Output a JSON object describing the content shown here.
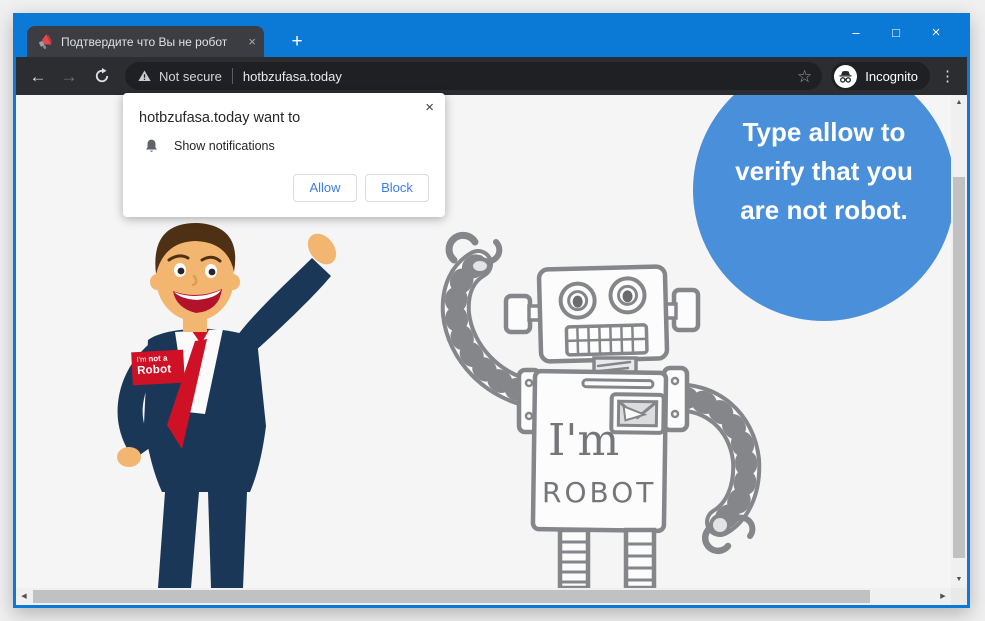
{
  "window": {
    "minimize": "–",
    "maximize": "□",
    "close": "×",
    "frame_color": "#0B7AD7"
  },
  "tab": {
    "title": "Подтвердите что Вы не робот",
    "close_icon": "×"
  },
  "tabbar": {
    "new_tab": "+"
  },
  "toolbar": {
    "back": "←",
    "forward": "→",
    "security_label": "Not secure",
    "url": "hotbzufasa.today",
    "bookmark_star": "☆",
    "incognito_label": "Incognito",
    "menu": "⋮"
  },
  "dialog": {
    "title": "hotbzufasa.today want to",
    "permission": "Show notifications",
    "allow_label": "Allow",
    "block_label": "Block",
    "close_icon": "×",
    "accent": "#3D7CF0"
  },
  "page": {
    "bubble": {
      "color": "#4A8FD9",
      "line1": "Type allow to",
      "line2": "verify that you",
      "line3": "are not robot."
    },
    "badge": {
      "color": "#CF1126",
      "line1_normal": "I'm ",
      "line1_bold": "not a",
      "line2": "Robot"
    },
    "robot": {
      "line1": "I'm",
      "line2": "ROBOT"
    }
  },
  "scroll": {
    "up": "▲",
    "down": "▼",
    "left": "◀",
    "right": "▶"
  }
}
